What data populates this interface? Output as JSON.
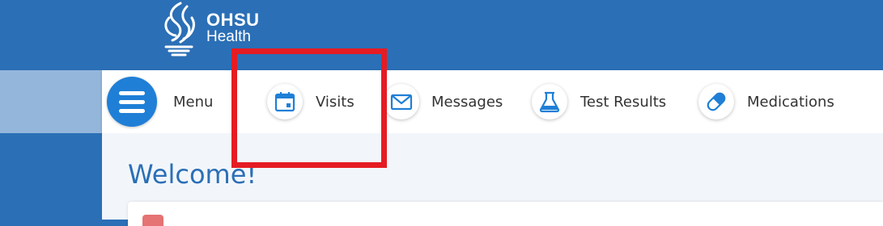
{
  "header": {
    "brand_line1": "OHSU",
    "brand_line2": "Health"
  },
  "nav": {
    "menu_label": "Menu",
    "items": [
      {
        "label": "Visits",
        "icon": "calendar-icon"
      },
      {
        "label": "Messages",
        "icon": "envelope-icon"
      },
      {
        "label": "Test Results",
        "icon": "flask-icon"
      },
      {
        "label": "Medications",
        "icon": "pill-icon"
      }
    ]
  },
  "main": {
    "welcome": "Welcome!"
  },
  "colors": {
    "brand_blue": "#2b6fb6",
    "accent_blue": "#1f7fd6",
    "highlight_red": "#e51c23"
  }
}
